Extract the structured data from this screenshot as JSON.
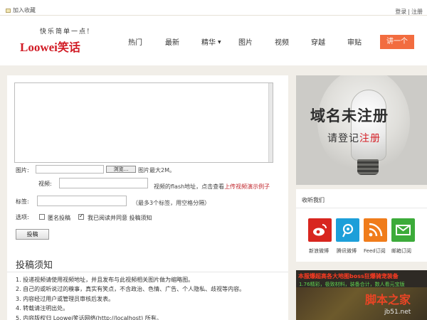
{
  "topbar": {
    "favorite": "加入收藏",
    "login": "登录",
    "sep": "|",
    "register": "注册"
  },
  "header": {
    "slogan": "快乐简单一点!",
    "logo_latin": "Loowei",
    "logo_cn": "笑话",
    "nav": [
      {
        "label": "热门"
      },
      {
        "label": "最新"
      },
      {
        "label": "精华",
        "has_dropdown": true
      },
      {
        "label": "图片"
      },
      {
        "label": "视频"
      },
      {
        "label": "穿越"
      },
      {
        "label": "审贴"
      }
    ],
    "cta": "讲一个",
    "colors": {
      "brand": "#d11b25",
      "cta": "#f26c3f"
    }
  },
  "form": {
    "content_value": "",
    "image_label": "图片:",
    "browse_button": "浏览...",
    "image_hint": "图片最大2M。",
    "video_label": "视频:",
    "video_hint_prefix": "视频的flash地址，点击查看",
    "video_hint_link": "上传视频演示例子",
    "tags_label": "标签:",
    "tags_hint": "（最多3个标签，用空格分隔）",
    "options_label": "选项:",
    "anonymous": {
      "label": "匿名投稿",
      "checked": false
    },
    "agree": {
      "label": "我已阅读并同意 投稿须知",
      "checked": true
    },
    "submit": "投稿"
  },
  "notice": {
    "title": "投稿须知",
    "items": [
      "1. 投递视频请使用视频地址，并且发布与此视频相关图片做为缩略图。",
      "2. 自己的或听说过的糗事，真实有笑点，不含政治、色情、广告、个人隐私、歧视等内容。",
      "3. 内容经过用户或管理员审核后发表。",
      "4. 转载请注明出处。",
      "5. 内容版权归 Loowei笑话网络(http://localhost) 所有。"
    ]
  },
  "sidebar": {
    "ad": {
      "title": "域名未注册",
      "subtitle_prefix": "请登记",
      "subtitle_highlight": "注册"
    },
    "follow": {
      "title": "收听我们",
      "items": [
        {
          "label": "新浪微博",
          "icon": "weibo-icon",
          "color": "#d8261f"
        },
        {
          "label": "腾讯微博",
          "icon": "tencent-weibo-icon",
          "color": "#1d9fd9"
        },
        {
          "label": "Feed订阅",
          "icon": "rss-icon",
          "color": "#f07c1b"
        },
        {
          "label": "邮箱订阅",
          "icon": "mail-icon",
          "color": "#3cab3a"
        }
      ]
    },
    "game": {
      "title": "本服爆超高各大地图boss狂爆骑宠装备",
      "line": "1.76精彩，极致材料，装备合计，数人看元宝版"
    }
  },
  "watermark": {
    "site": "脚本之家",
    "small": "jb51.net"
  }
}
